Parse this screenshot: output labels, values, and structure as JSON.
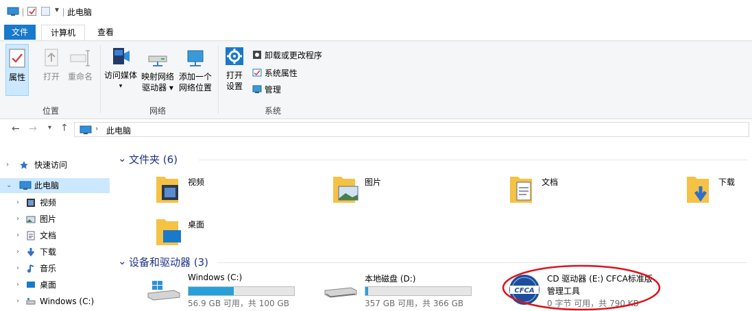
{
  "window": {
    "title": "此电脑"
  },
  "ribbon": {
    "tabs": [
      "文件",
      "计算机",
      "查看"
    ],
    "location": {
      "label": "位置",
      "properties": "属性",
      "open": "打开",
      "rename": "重命名"
    },
    "network": {
      "label": "网络",
      "access_media": "访问媒体",
      "map_drive_line1": "映射网络",
      "map_drive_line2": "驱动器 ▾",
      "add_location_line1": "添加一个",
      "add_location_line2": "网络位置"
    },
    "system": {
      "label": "系统",
      "open_settings_line1": "打开",
      "open_settings_line2": "设置",
      "uninstall": "卸载或更改程序",
      "system_properties": "系统属性",
      "manage": "管理"
    }
  },
  "address": {
    "path_text": "此电脑"
  },
  "nav": {
    "items": [
      {
        "label": "快速访问",
        "icon": "star-icon"
      },
      {
        "label": "此电脑",
        "icon": "pc-icon"
      },
      {
        "label": "视频",
        "icon": "video-icon"
      },
      {
        "label": "图片",
        "icon": "picture-icon"
      },
      {
        "label": "文档",
        "icon": "document-icon"
      },
      {
        "label": "下载",
        "icon": "download-icon"
      },
      {
        "label": "音乐",
        "icon": "music-icon"
      },
      {
        "label": "桌面",
        "icon": "desktop-icon"
      },
      {
        "label": "Windows (C:)",
        "icon": "drive-icon"
      }
    ]
  },
  "content": {
    "folders_header": "文件夹 (6)",
    "folders": [
      {
        "name": "视频"
      },
      {
        "name": "图片"
      },
      {
        "name": "文档"
      },
      {
        "name": "下载"
      },
      {
        "name": "桌面"
      }
    ],
    "devices_header": "设备和驱动器 (3)",
    "drives": [
      {
        "name": "Windows (C:)",
        "free": "56.9 GB 可用，共 100 GB",
        "used_fraction": 0.43
      },
      {
        "name": "本地磁盘 (D:)",
        "free": "357 GB 可用，共 366 GB",
        "used_fraction": 0.025
      },
      {
        "name_line1": "CD 驱动器 (E:) CFCA标准版",
        "name_line2": "管理工具",
        "free": "0 字节 可用，共 790 KB",
        "logo_text": "CFCA"
      }
    ]
  },
  "colors": {
    "accent": "#1979ca",
    "selection": "#cce8ff",
    "header_text": "#1e3287",
    "drive_bar": "#26a0da",
    "annotation_circle": "#e0101a"
  }
}
